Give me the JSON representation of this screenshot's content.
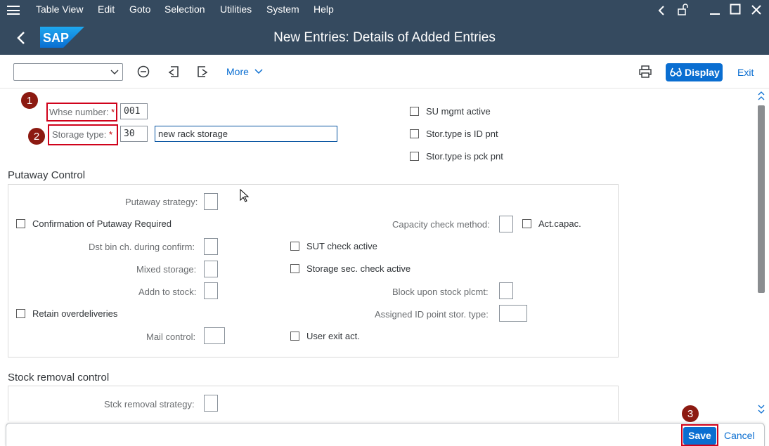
{
  "menubar": {
    "items": [
      "Table View",
      "Edit",
      "Goto",
      "Selection",
      "Utilities",
      "System",
      "Help"
    ]
  },
  "shell": {
    "title": "New Entries: Details of Added Entries",
    "logo_text": "SAP"
  },
  "toolbar": {
    "more_label": "More",
    "display_label": "Display",
    "exit_label": "Exit",
    "select_value": ""
  },
  "header_fields": {
    "whse_label": "Whse number:",
    "whse_value": "001",
    "stortype_label": "Storage type:",
    "stortype_value": "30",
    "stortype_desc": "new rack storage",
    "required_mark": "*",
    "su_mgmt": "SU mgmt active",
    "id_pnt": "Stor.type is ID pnt",
    "pck_pnt": "Stor.type is pck pnt"
  },
  "putaway": {
    "title": "Putaway Control",
    "putaway_strategy": "Putaway strategy:",
    "confirmation": "Confirmation of Putaway Required",
    "capacity_method": "Capacity check method:",
    "act_capac": "Act.capac.",
    "dst_bin": "Dst bin ch. during confirm:",
    "sut_check": "SUT check active",
    "mixed_storage": "Mixed storage:",
    "storage_sec": "Storage sec. check active",
    "addn_stock": "Addn to stock:",
    "block_stock": "Block upon stock plcmt:",
    "retain_over": "Retain overdeliveries",
    "assigned_id": "Assigned ID point stor. type:",
    "mail_control": "Mail control:",
    "user_exit": "User exit act."
  },
  "removal": {
    "title": "Stock removal control",
    "strategy": "Stck removal strategy:"
  },
  "footer": {
    "save_label": "Save",
    "cancel_label": "Cancel"
  },
  "badges": {
    "one": "1",
    "two": "2",
    "three": "3"
  },
  "colors": {
    "shell": "#354a5f",
    "accent": "#0a6ed1",
    "badge": "#8c1a11",
    "highlight": "#d0021b"
  }
}
